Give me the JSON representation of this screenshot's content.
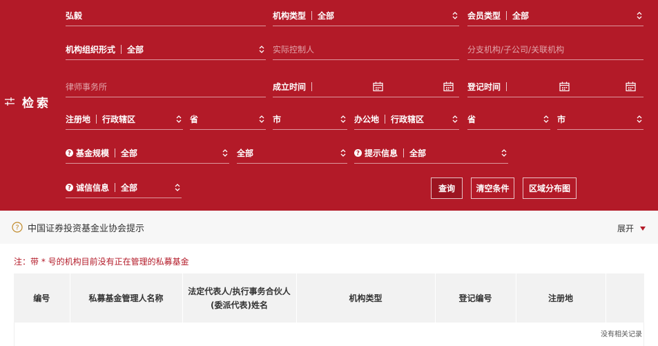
{
  "search": {
    "title": "检索",
    "name_value": "弘毅",
    "org_type": {
      "label": "机构类型",
      "value": "全部"
    },
    "member_type": {
      "label": "会员类型",
      "value": "全部"
    },
    "org_form": {
      "label": "机构组织形式",
      "value": "全部"
    },
    "controller_placeholder": "实际控制人",
    "branch_placeholder": "分支机构/子公司/关联机构",
    "law_firm_placeholder": "律师事务所",
    "founded_label": "成立时间",
    "registered_label": "登记时间",
    "reg_place": {
      "label": "注册地",
      "region": "行政辖区",
      "province": "省",
      "city": "市"
    },
    "office_place": {
      "label": "办公地",
      "region": "行政辖区",
      "province": "省",
      "city": "市"
    },
    "fund_scale": {
      "label": "基金规模",
      "value": "全部",
      "second_value": "全部"
    },
    "hint_info": {
      "label": "提示信息",
      "value": "全部"
    },
    "integrity": {
      "label": "诚信信息",
      "value": "全部"
    },
    "buttons": {
      "query": "查询",
      "clear": "清空条件",
      "map": "区域分布图"
    }
  },
  "notice": {
    "text": "中国证券投资基金业协会提示",
    "expand": "展开"
  },
  "note": "注：带 * 号的机构目前没有正在管理的私募基金",
  "table": {
    "headers": [
      "编号",
      "私募基金管理人名称",
      "法定代表人/执行事务合伙人",
      "(委派代表)姓名",
      "机构类型",
      "登记编号",
      "注册地"
    ],
    "empty_text": "没有相关记录"
  },
  "colors": {
    "brand_red": "#b31a28",
    "notice_bg": "#f7f7f7",
    "table_header_bg": "#f2f2f2"
  },
  "icons": [
    "filter-icon",
    "sort-arrows-icon",
    "calendar-icon",
    "question-circle-icon",
    "caret-down-icon"
  ]
}
